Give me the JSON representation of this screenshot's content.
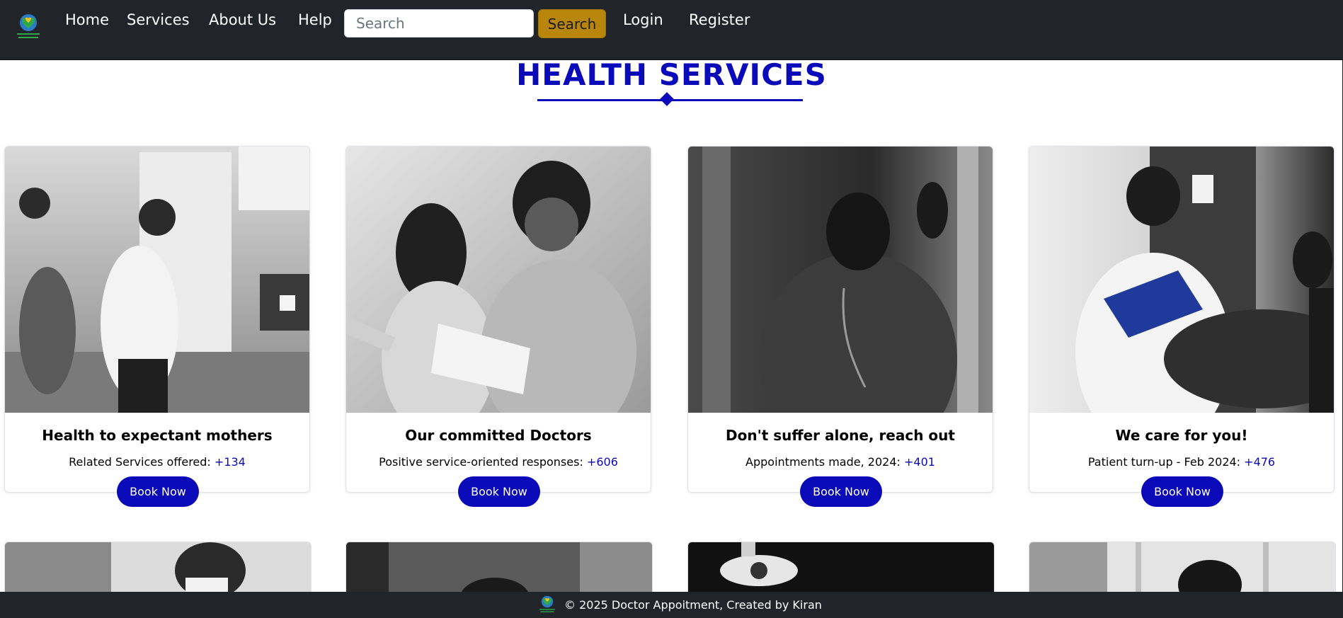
{
  "nav": {
    "logo_icon": "heart-logo-icon",
    "links": [
      "Home",
      "Services",
      "About Us",
      "Help"
    ],
    "search": {
      "placeholder": "Search",
      "value": "",
      "button_label": "Search"
    },
    "auth": [
      "Login",
      "Register"
    ]
  },
  "section": {
    "title": "HEALTH SERVICES"
  },
  "cards": [
    {
      "title": "Health to expectant mothers",
      "stat_label": "Related Services offered:",
      "stat_value": "+134",
      "button_label": "Book Now",
      "image": "doctor-with-expectant-mother-photo"
    },
    {
      "title": "Our committed Doctors",
      "stat_label": "Positive service-oriented responses:",
      "stat_value": "+606",
      "button_label": "Book Now",
      "image": "smiling-nurses-with-folders-photo"
    },
    {
      "title": "Don't suffer alone, reach out",
      "stat_label": "Appointments made, 2024:",
      "stat_value": "+401",
      "button_label": "Book Now",
      "image": "distressed-doctor-photo"
    },
    {
      "title": "We care for you!",
      "stat_label": "Patient turn-up - Feb 2024:",
      "stat_value": "+476",
      "button_label": "Book Now",
      "image": "doctor-reviewing-clipboard-photo"
    }
  ],
  "footer": {
    "text": "© 2025 Doctor Appoitment, Created by Kiran",
    "logo_icon": "heart-logo-icon"
  },
  "colors": {
    "nav_bg": "#212529",
    "accent": "#0a0ab8",
    "search_button": "#b8860b"
  }
}
